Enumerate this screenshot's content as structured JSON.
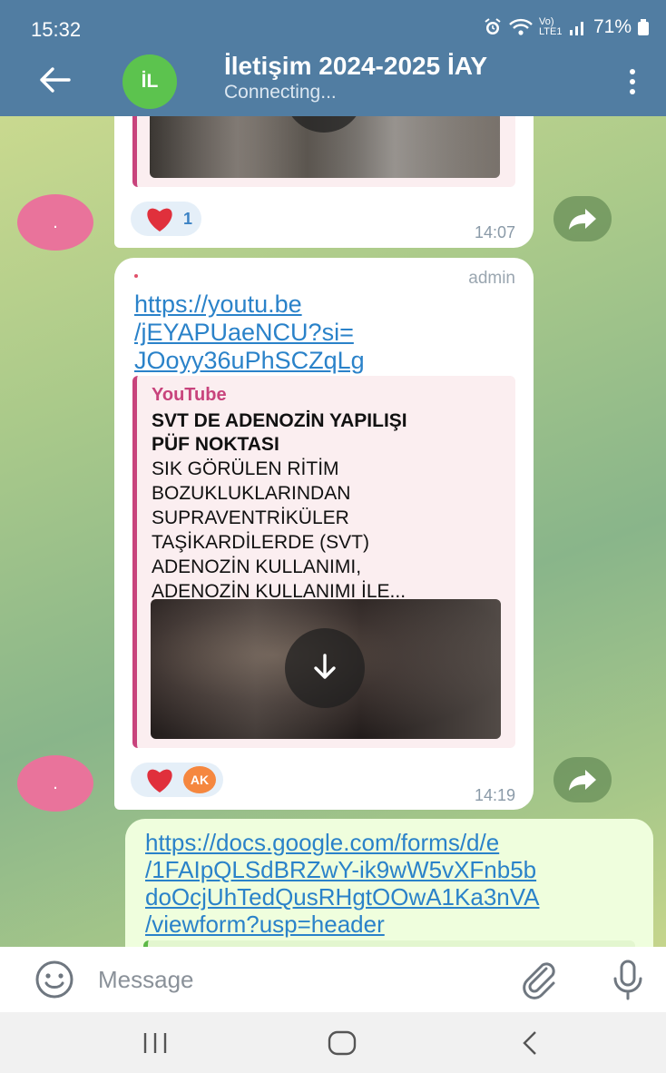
{
  "status_bar": {
    "time": "15:32",
    "network": "Vo) LTE1",
    "battery": "71%",
    "icons": [
      "alarm-icon",
      "wifi-icon",
      "signal-icon",
      "battery-icon"
    ]
  },
  "header": {
    "avatar_initials": "İL",
    "title": "İletişim 2024-2025 İAY",
    "subtitle": "Connecting...",
    "icons": [
      "back-arrow-icon",
      "more-vert-icon"
    ]
  },
  "messages": [
    {
      "id": "msg1",
      "sender_avatar": ".",
      "reaction": {
        "emoji": "heart",
        "count": "1"
      },
      "time": "14:07"
    },
    {
      "id": "msg2",
      "sender": ".",
      "badge": "admin",
      "link_lines": [
        "https://youtu.be",
        "/jEYAPUaeNCU?si=",
        "JOoyy36uPhSCZqLg"
      ],
      "preview": {
        "site": "YouTube",
        "title_lines": [
          "SVT DE ADENOZİN YAPILIŞI",
          "PÜF NOKTASI"
        ],
        "description_lines": [
          "SIK GÖRÜLEN RİTİM",
          "BOZUKLUKLARINDAN",
          "SUPRAVENTRİKÜLER",
          "TAŞİKARDİLERDE (SVT)",
          "ADENOZİN KULLANIMI,",
          "ADENOZİN KULLANIMI İLE..."
        ]
      },
      "sender_avatar": ".",
      "reactions": [
        {
          "emoji": "heart"
        },
        {
          "initials": "AK"
        }
      ],
      "time": "14:19"
    },
    {
      "id": "msg3",
      "link_lines": [
        "https://docs.google.com/forms/d/e",
        "/1FAIpQLSdBRZwY-ik9wW5vXFnb5b",
        "doOcjUhTedQusRHgtOOwA1Ka3nVA",
        "/viewform?usp=header"
      ]
    }
  ],
  "composer": {
    "placeholder": "Message",
    "icons": [
      "emoji-icon",
      "attach-icon",
      "mic-icon"
    ]
  },
  "navbar": {
    "icons": [
      "recents-icon",
      "home-icon",
      "back-icon"
    ]
  },
  "colors": {
    "header": "#517da2",
    "link": "#2a82c9",
    "accent_pink": "#c8437c",
    "avatar_header": "#5cc34e",
    "avatar_sender": "#e9739b",
    "outgoing_bubble": "#effedd"
  }
}
